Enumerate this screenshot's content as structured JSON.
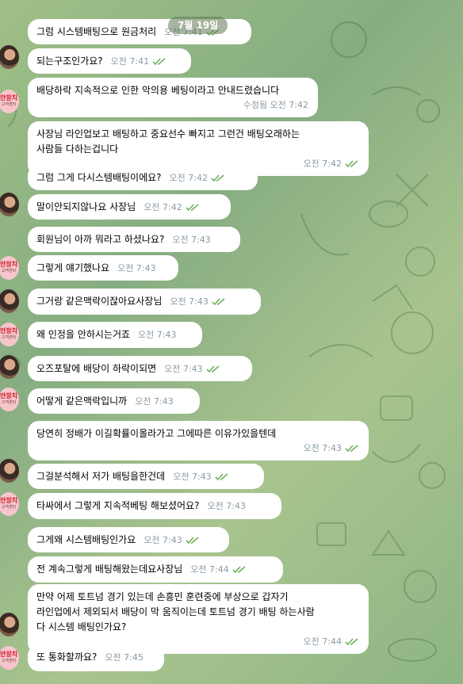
{
  "date_divider": "7월 19일",
  "messages": [
    {
      "text": "그럼 시스템배팅으로 원금처리",
      "time": "오전 7:41",
      "read": true
    },
    {
      "text": "되는구조인가요?",
      "time": "오전 7:41",
      "read": true
    },
    {
      "text": "배당하락 지속적으로 인한 악의용 베팅이라고 안내드렸습니다",
      "time": "수정됨 오전 7:42",
      "read": false
    },
    {
      "text": "사장님 라인업보고 배팅하고 중요선수 빠지고 그런건 배팅오래하는\n사람들 다하는겁니다",
      "time": "오전 7:42",
      "read": true
    },
    {
      "text": "그럼 그게 다시스템배팅이에요?",
      "time": "오전 7:42",
      "read": true
    },
    {
      "text": "말이안되지않나요 사장님",
      "time": "오전 7:42",
      "read": true
    },
    {
      "text": "회원님이 아까 뭐라고 하셨나요?",
      "time": "오전 7:43",
      "read": false
    },
    {
      "text": "그렇게 얘기했나요",
      "time": "오전 7:43",
      "read": false
    },
    {
      "text": "그거랑 같은맥락이잖아요사장님",
      "time": "오전 7:43",
      "read": true
    },
    {
      "text": "왜 인정을 안하시는거죠",
      "time": "오전 7:43",
      "read": false
    },
    {
      "text": "오즈포탈에 배당이 하락이되면",
      "time": "오전 7:43",
      "read": true
    },
    {
      "text": "어떻게 같은맥락입니까",
      "time": "오전 7:43",
      "read": false
    },
    {
      "text": "당연히 정배가 이길확률이올라가고 그에따른 이유가있을텐데",
      "time": "오전 7:43",
      "read": true
    },
    {
      "text": "그걸분석해서 저가 배팅을한건데",
      "time": "오전 7:43",
      "read": true
    },
    {
      "text": "타싸에서 그렇게 지속적베팅 해보셨어요?",
      "time": "오전 7:43",
      "read": false
    },
    {
      "text": "그게왜 시스템배팅인가요",
      "time": "오전 7:43",
      "read": true
    },
    {
      "text": "전 계속그렇게 배팅해왔는데요사장님",
      "time": "오전 7:44",
      "read": true
    },
    {
      "text": "만약 어제 토트넘 경기 있는데 손흥민 훈련중에 부상으로 갑자기\n라인업에서 제외되서 배당이 막 움직이는데 토트넘 경기 배팅 하는사람\n다 시스템 배팅인가요?",
      "time": "오전 7:44",
      "read": true
    },
    {
      "text": "또 통화할까요?",
      "time": "오전 7:45",
      "read": false
    }
  ],
  "avatars": {
    "logo_text": "안장치",
    "logo_sub": "고객센터"
  }
}
